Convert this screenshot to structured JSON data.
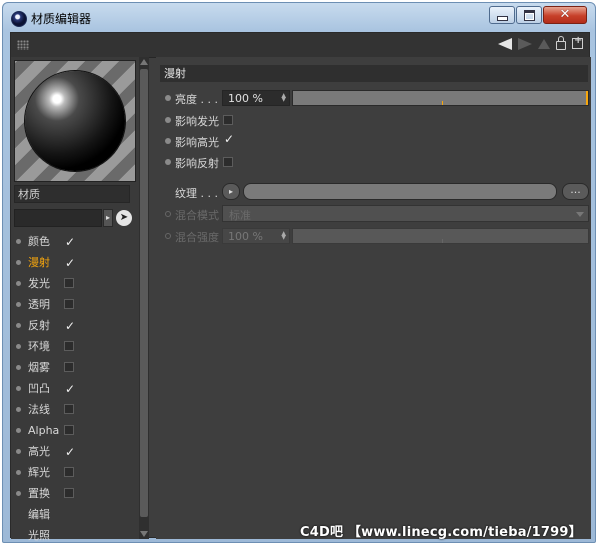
{
  "window": {
    "title": "材质编辑器",
    "minimize_icon": "minimize-icon",
    "maximize_icon": "maximize-icon",
    "close_icon": "close-icon",
    "close_glyph": "✕"
  },
  "material": {
    "name": "材质",
    "pick_glyph": "➤",
    "menu_glyph": "▸"
  },
  "channels": [
    {
      "label": "颜色",
      "checked": true
    },
    {
      "label": "漫射",
      "checked": true,
      "active": true
    },
    {
      "label": "发光",
      "checked": false
    },
    {
      "label": "透明",
      "checked": false
    },
    {
      "label": "反射",
      "checked": true
    },
    {
      "label": "环境",
      "checked": false
    },
    {
      "label": "烟雾",
      "checked": false
    },
    {
      "label": "凹凸",
      "checked": true
    },
    {
      "label": "法线",
      "checked": false
    },
    {
      "label": "Alpha",
      "checked": false
    },
    {
      "label": "高光",
      "checked": true
    },
    {
      "label": "辉光",
      "checked": false
    },
    {
      "label": "置换",
      "checked": false
    },
    {
      "label": "编辑",
      "no_checkbox": true
    },
    {
      "label": "光照",
      "no_checkbox": true
    }
  ],
  "diffuse": {
    "section_title": "漫射",
    "brightness_label": "亮度 . . .",
    "brightness_value": "100 %",
    "brightness_level": 1.0,
    "affect_luminance_label": "影响发光",
    "affect_luminance": false,
    "affect_specular_label": "影响高光",
    "affect_specular": true,
    "affect_reflection_label": "影响反射",
    "affect_reflection": false,
    "texture_label": "纹理 . . .",
    "texture_more": "...",
    "mix_mode_label": "混合模式",
    "mix_mode_value": "标准",
    "mix_strength_label": "混合强度",
    "mix_strength_value": "100 %"
  },
  "accent_color": "#f6a60d",
  "watermark": "C4D吧 【www.linecg.com/tieba/1799】"
}
